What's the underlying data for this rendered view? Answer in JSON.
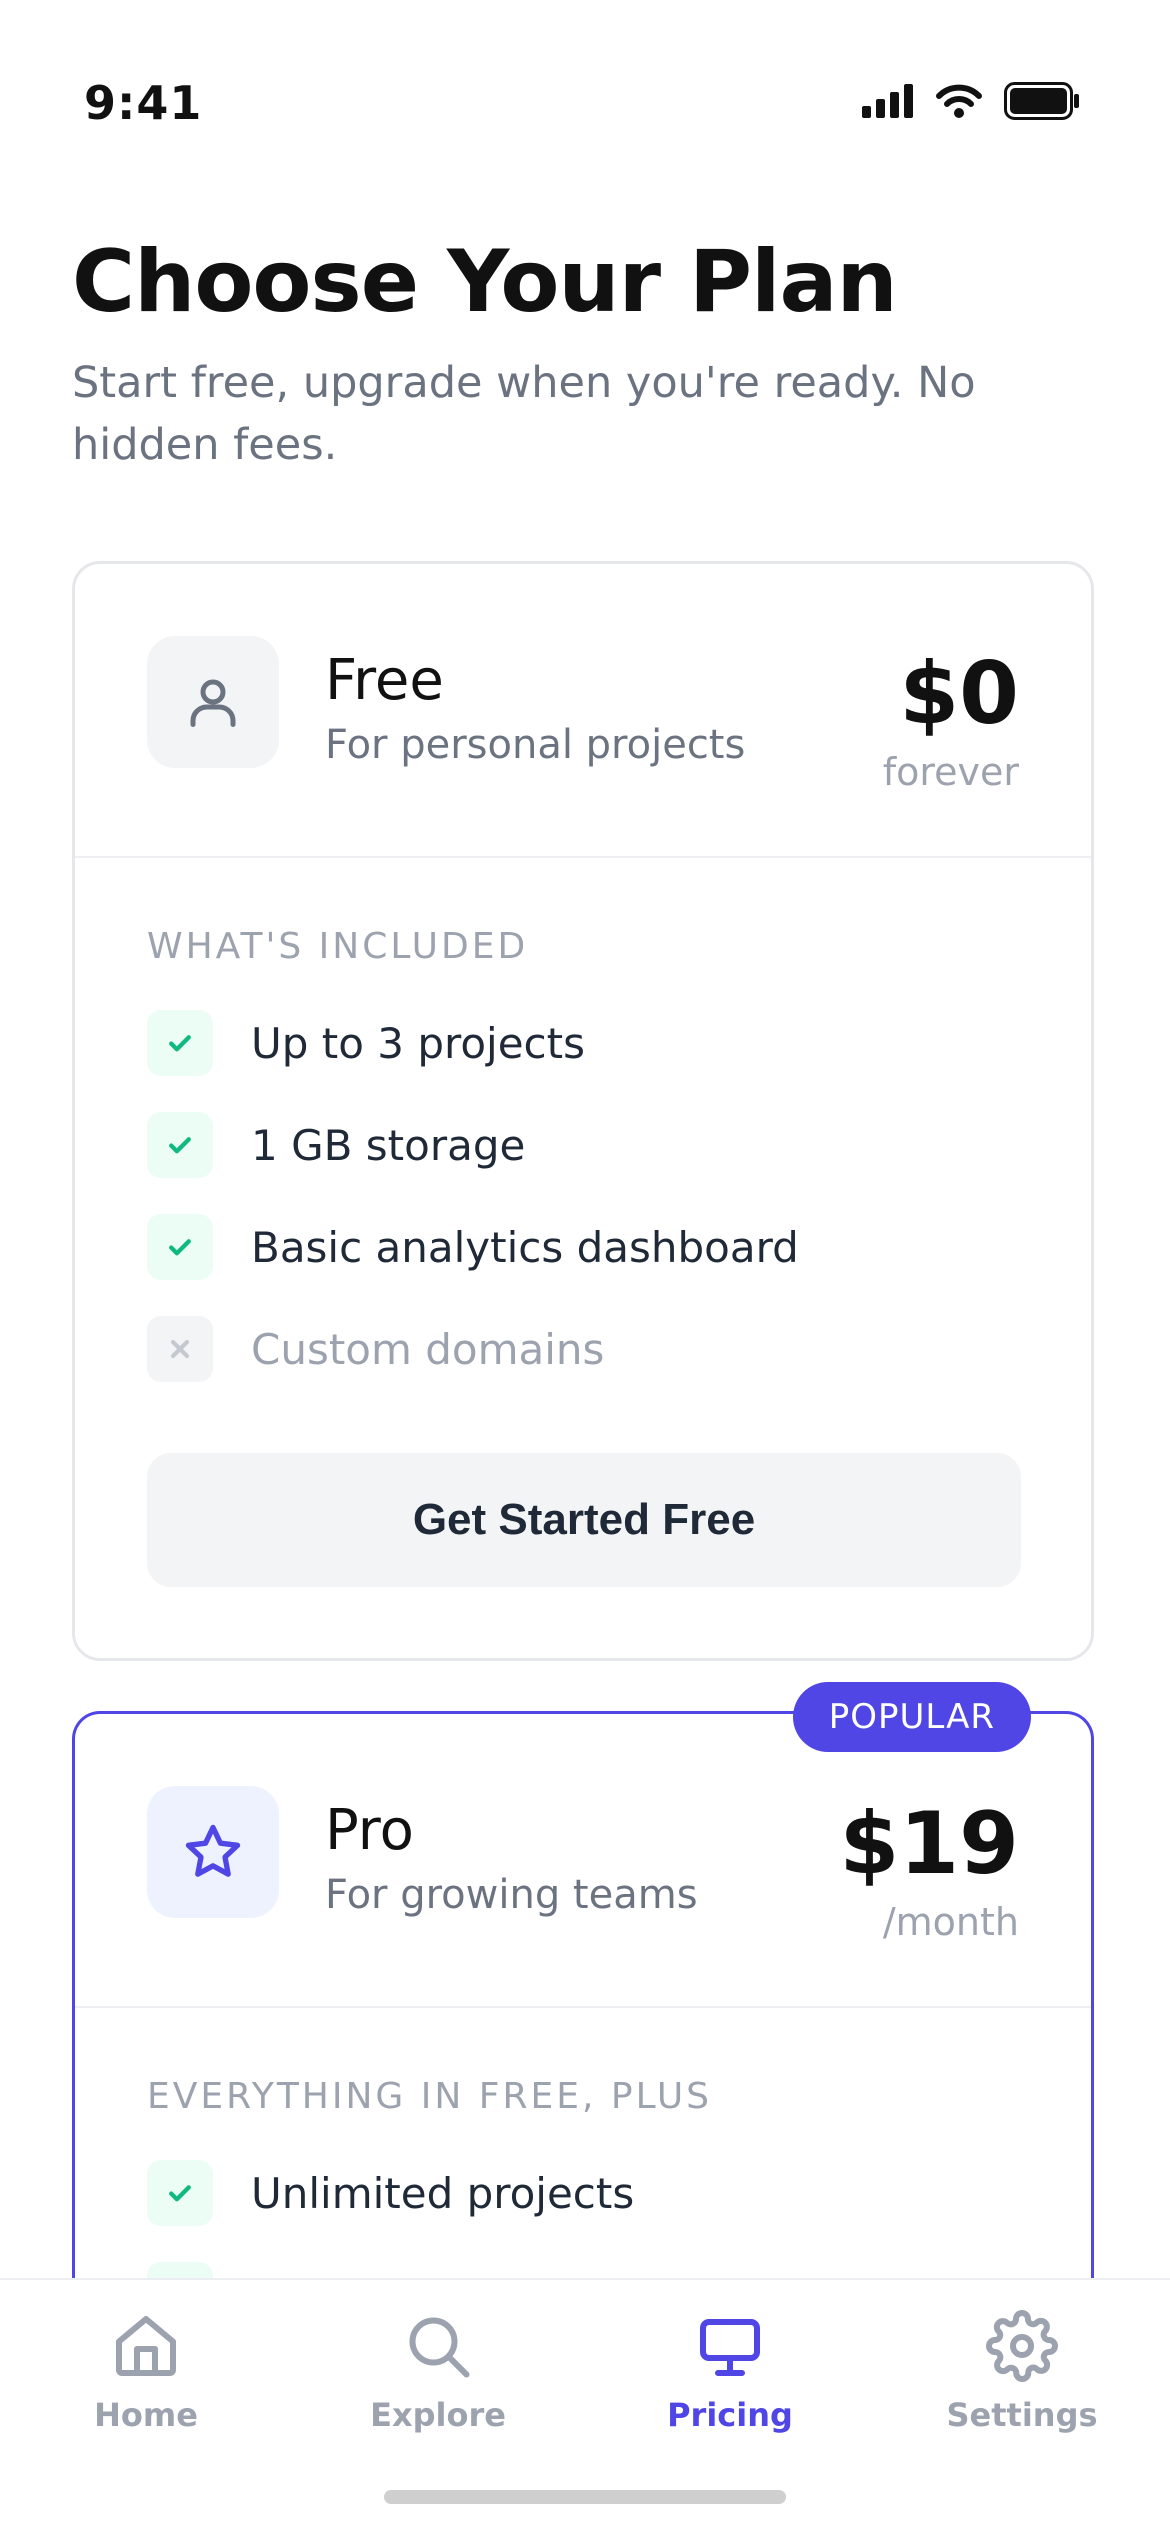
{
  "status_bar": {
    "time": "9:41",
    "icons": [
      "signal-icon",
      "wifi-icon",
      "battery-icon"
    ]
  },
  "header": {
    "title": "Choose Your Plan",
    "subtitle": "Start free, upgrade when you're ready. No hidden fees."
  },
  "plans": [
    {
      "name": "Free",
      "tagline": "For personal projects",
      "price": "$0",
      "period": "forever",
      "icon": "user-icon",
      "features_heading": "WHAT'S INCLUDED",
      "features": [
        {
          "label": "Up to 3 projects",
          "included": true
        },
        {
          "label": "1 GB storage",
          "included": true
        },
        {
          "label": "Basic analytics dashboard",
          "included": true
        },
        {
          "label": "Custom domains",
          "included": false
        }
      ],
      "cta": "Get Started Free"
    },
    {
      "name": "Pro",
      "tagline": "For growing teams",
      "price": "$19",
      "period": "/month",
      "icon": "star-icon",
      "badge": "POPULAR",
      "features_heading": "EVERYTHING IN FREE, PLUS",
      "features": [
        {
          "label": "Unlimited projects",
          "included": true
        }
      ]
    }
  ],
  "tab_bar": {
    "active": "Pricing",
    "tabs": [
      {
        "label": "Home",
        "icon": "home-icon"
      },
      {
        "label": "Explore",
        "icon": "search-icon"
      },
      {
        "label": "Pricing",
        "icon": "monitor-icon"
      },
      {
        "label": "Settings",
        "icon": "gear-icon"
      }
    ]
  },
  "colors": {
    "accent": "#4f46e5",
    "check": "#10b981",
    "check_bg": "#ecfdf5",
    "muted_text": "#6b7280",
    "border": "#e5e7eb"
  }
}
